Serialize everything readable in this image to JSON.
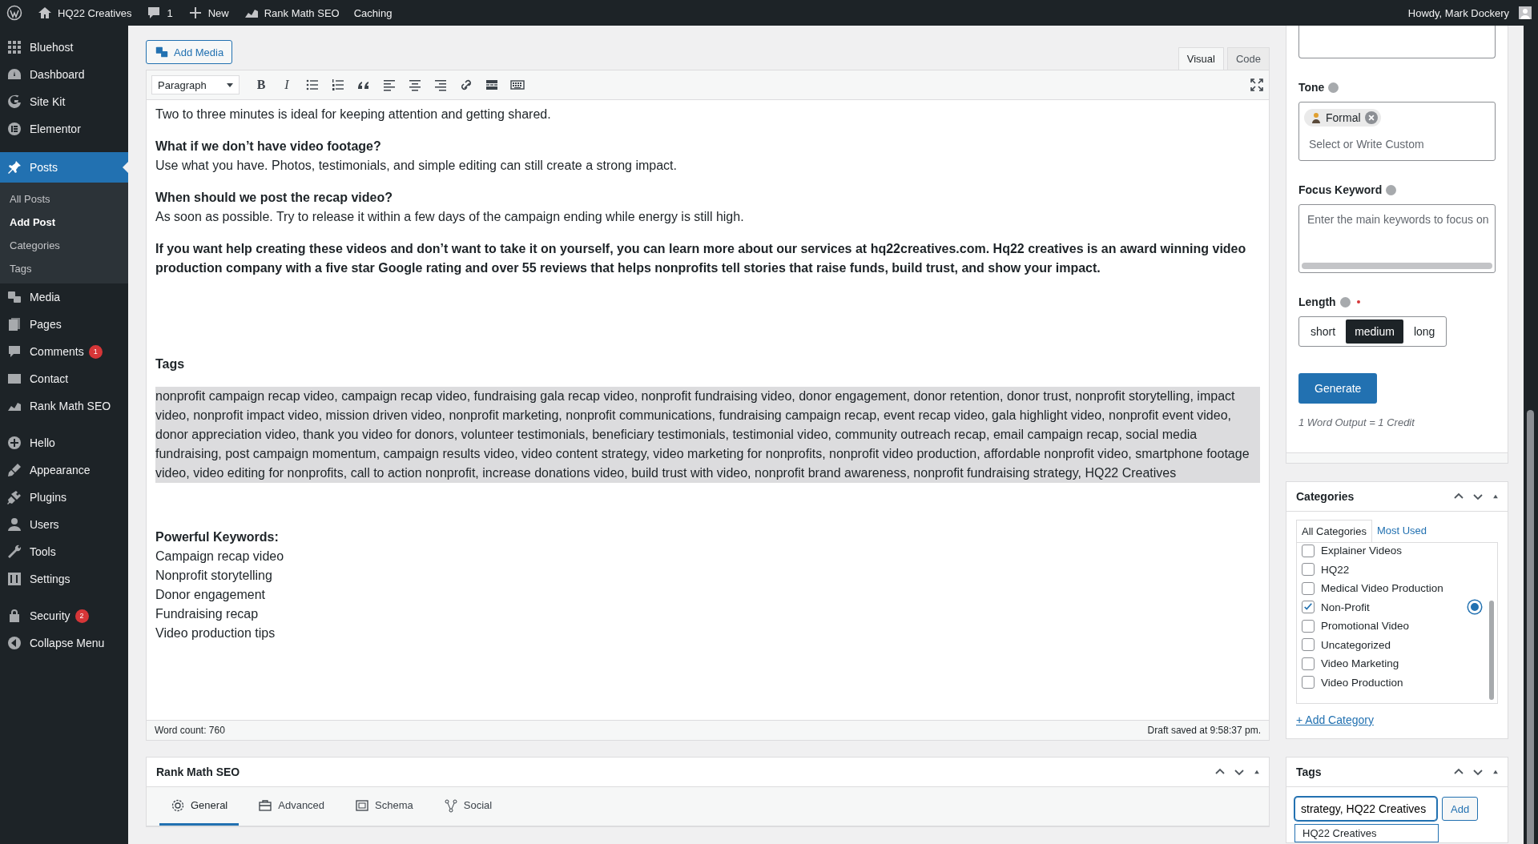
{
  "admin_bar": {
    "site": "HQ22 Creatives",
    "comments": "1",
    "new": "New",
    "items": [
      {
        "kind": "rankmath",
        "label": "Rank Math SEO"
      },
      {
        "kind": "plain",
        "label": "Caching"
      }
    ],
    "howdy": "Howdy, Mark Dockery"
  },
  "sidebar": {
    "groups": [
      [
        {
          "kind": "grid",
          "label": "Bluehost",
          "selected": false
        },
        {
          "kind": "dashboard",
          "label": "Dashboard",
          "selected": false
        },
        {
          "kind": "g",
          "label": "Site Kit",
          "selected": false
        },
        {
          "kind": "e",
          "label": "Elementor",
          "selected": false
        }
      ],
      [
        {
          "kind": "pin",
          "label": "Posts",
          "selected": true,
          "children": [
            {
              "label": "All Posts",
              "selected": false
            },
            {
              "label": "Add Post",
              "selected": true
            },
            {
              "label": "Categories",
              "selected": false
            },
            {
              "label": "Tags",
              "selected": false
            }
          ]
        },
        {
          "kind": "media",
          "label": "Media",
          "selected": false
        },
        {
          "kind": "pages",
          "label": "Pages",
          "selected": false
        },
        {
          "kind": "comment",
          "label": "Comments",
          "selected": false,
          "badge": "1"
        },
        {
          "kind": "mail",
          "label": "Contact",
          "selected": false
        },
        {
          "kind": "chart",
          "label": "Rank Math SEO",
          "selected": false
        }
      ],
      [
        {
          "kind": "plus",
          "label": "Hello",
          "selected": false
        },
        {
          "kind": "brush",
          "label": "Appearance",
          "selected": false
        },
        {
          "kind": "plug",
          "label": "Plugins",
          "selected": false
        },
        {
          "kind": "user",
          "label": "Users",
          "selected": false
        },
        {
          "kind": "wrench",
          "label": "Tools",
          "selected": false
        },
        {
          "kind": "settings",
          "label": "Settings",
          "selected": false
        }
      ],
      [
        {
          "kind": "lock",
          "label": "Security",
          "selected": false,
          "badge": "2"
        },
        {
          "kind": "collapse",
          "label": "Collapse Menu",
          "selected": false
        }
      ]
    ]
  },
  "editor": {
    "add_media": "Add Media",
    "tabs": [
      {
        "label": "Visual",
        "selected": true
      },
      {
        "label": "Code",
        "selected": false
      }
    ],
    "format": "Paragraph",
    "toolbar": [
      {
        "kind": "bold",
        "text": "B"
      },
      {
        "kind": "italic",
        "text": "I"
      },
      {
        "kind": "ul"
      },
      {
        "kind": "ol"
      },
      {
        "kind": "quote"
      },
      {
        "kind": "alignleft"
      },
      {
        "kind": "aligncenter"
      },
      {
        "kind": "alignright"
      },
      {
        "kind": "link"
      },
      {
        "kind": "more"
      },
      {
        "kind": "keyboard"
      }
    ],
    "blocks": [
      {
        "kind": "text",
        "text": "Two to three minutes is ideal for keeping attention and getting shared."
      },
      {
        "kind": "qa",
        "question": "What if we don’t have video footage?",
        "answer": "Use what you have. Photos, testimonials, and simple editing can still create a strong impact."
      },
      {
        "kind": "qa",
        "question": "When should we post the recap video?",
        "answer": "As soon as possible. Try to release it within a few days of the campaign ending while energy is still high."
      },
      {
        "kind": "strong",
        "text": "If you want help creating these videos and don’t want to take it on yourself, you can learn more about our services at hq22creatives.com. Hq22 creatives is an award winning video production company with a five star Google rating and over 55 reviews that helps nonprofits tell stories that raise funds, build trust, and show your impact."
      },
      {
        "kind": "heading",
        "text": "Tags"
      },
      {
        "kind": "highlight",
        "text": "nonprofit campaign recap video, campaign recap video, fundraising gala recap video, nonprofit fundraising video, donor engagement, donor retention, donor trust, nonprofit storytelling, impact video, nonprofit impact video, mission driven video, nonprofit marketing, nonprofit communications, fundraising campaign recap, event recap video, gala highlight video, nonprofit event video, donor appreciation video, thank you video for donors, volunteer testimonials, beneficiary testimonials, testimonial video, community outreach recap, email campaign recap, social media fundraising, post campaign momentum, campaign results video, video content strategy, video marketing for nonprofits, nonprofit video production, affordable nonprofit video, smartphone footage video, video editing for nonprofits, call to action nonprofit, increase donations video, build trust with video, nonprofit brand awareness, nonprofit fundraising strategy, HQ22 Creatives"
      },
      {
        "kind": "keywords",
        "title": "Powerful Keywords:",
        "items": [
          "Campaign recap video",
          "Nonprofit storytelling",
          "Donor engagement",
          "Fundraising recap",
          "Video production tips"
        ]
      }
    ],
    "word_count": "Word count: 760",
    "draft_saved": "Draft saved at 9:58:37 pm."
  },
  "rank_math": {
    "title": "Rank Math SEO",
    "tabs": [
      {
        "kind": "gear",
        "label": "General",
        "selected": true
      },
      {
        "kind": "briefcase",
        "label": "Advanced",
        "selected": false
      },
      {
        "kind": "schema",
        "label": "Schema",
        "selected": false
      },
      {
        "kind": "share",
        "label": "Social",
        "selected": false
      }
    ]
  },
  "ai_panel": {
    "tone_label": "Tone",
    "tone_chip": "Formal",
    "tone_placeholder": "Select or Write Custom",
    "keyword_label": "Focus Keyword",
    "keyword_placeholder": "Enter the main keywords to focus on",
    "length_label": "Length",
    "length_options": [
      {
        "label": "short",
        "selected": false
      },
      {
        "label": "medium",
        "selected": true
      },
      {
        "label": "long",
        "selected": false
      }
    ],
    "generate": "Generate",
    "credit_note": "1 Word Output = 1 Credit"
  },
  "categories": {
    "title": "Categories",
    "tabs": [
      {
        "label": "All Categories",
        "selected": true
      },
      {
        "label": "Most Used",
        "selected": false
      }
    ],
    "items": [
      {
        "label": "Explainer Videos",
        "checked": false,
        "primary": false
      },
      {
        "label": "HQ22",
        "checked": false,
        "primary": false
      },
      {
        "label": "Medical Video Production",
        "checked": false,
        "primary": false
      },
      {
        "label": "Non-Profit",
        "checked": true,
        "primary": true
      },
      {
        "label": "Promotional Video",
        "checked": false,
        "primary": false
      },
      {
        "label": "Uncategorized",
        "checked": false,
        "primary": false
      },
      {
        "label": "Video Marketing",
        "checked": false,
        "primary": false
      },
      {
        "label": "Video Production",
        "checked": false,
        "primary": false
      }
    ],
    "add_link": "+ Add Category"
  },
  "tags": {
    "title": "Tags",
    "value": "strategy, HQ22 Creatives",
    "add": "Add",
    "suggestion": "HQ22 Creatives"
  }
}
